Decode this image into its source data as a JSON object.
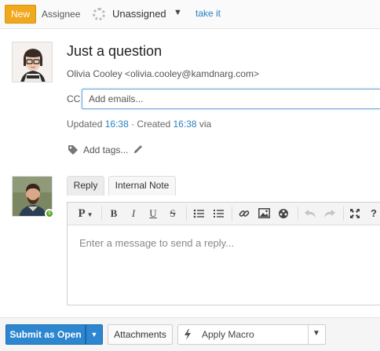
{
  "topbar": {
    "status_badge": "New",
    "assignee_label": "Assignee",
    "assignee_value": "Unassigned",
    "take_link": "take it"
  },
  "ticket": {
    "subject": "Just a question",
    "from": "Olivia Cooley <olivia.cooley@kamdnarg.com>",
    "cc_label": "CC",
    "cc_placeholder": "Add emails...",
    "updated_label": "Updated",
    "updated_time": "16:38",
    "created_label": "· Created",
    "created_time": "16:38",
    "via_label": "via",
    "add_tags": "Add tags..."
  },
  "composer": {
    "tabs": [
      {
        "label": "Reply",
        "active": true
      },
      {
        "label": "Internal Note",
        "active": false
      }
    ],
    "toolbar": {
      "paragraph": "P",
      "bold": "B",
      "italic": "I",
      "underline": "U",
      "strikethrough": "S",
      "help": "?"
    },
    "placeholder": "Enter a message to send a reply..."
  },
  "footer": {
    "submit_label": "Submit as Open",
    "attachments_label": "Attachments",
    "macro_label": "Apply Macro"
  },
  "colors": {
    "new_badge": "#f0a81c",
    "submit": "#2d86d0",
    "link": "#2a7fbf",
    "agent_status": "#5aa52a"
  }
}
